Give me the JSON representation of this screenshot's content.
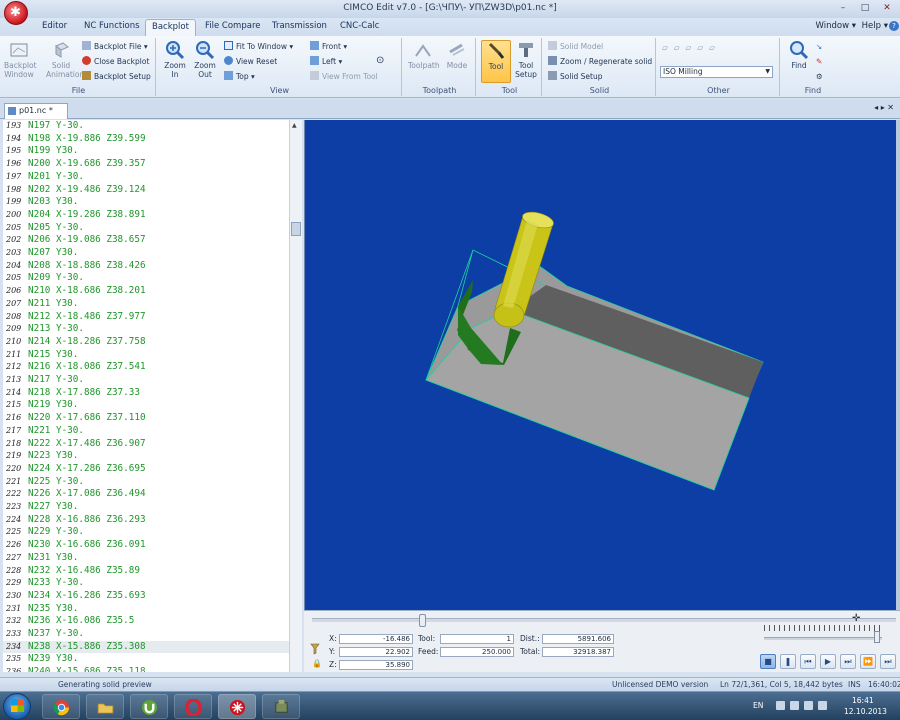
{
  "window": {
    "title": "CIMCO Edit v7.0 - [G:\\ЧПУ\\- УП\\ZW3D\\p01.nc *]",
    "minimize": "–",
    "maximize": "□",
    "close": "✕"
  },
  "menu": {
    "tabs": [
      "Editor",
      "NC Functions",
      "Backplot",
      "File Compare",
      "Transmission",
      "CNC-Calc"
    ],
    "active": "Backplot",
    "window_label": "Window ▾",
    "help_label": "Help ▾"
  },
  "ribbon": {
    "file": {
      "label": "File",
      "backplot_window": "Backplot Window",
      "solid_animation": "Solid Animation",
      "backplot_file": "Backplot File ▾",
      "close_backplot": "Close Backplot",
      "backplot_setup": "Backplot Setup"
    },
    "view": {
      "label": "View",
      "zoom_in": "Zoom In",
      "zoom_out": "Zoom Out",
      "fit_to_window": "Fit To Window ▾",
      "view_reset": "View Reset",
      "top": "Top ▾",
      "front": "Front ▾",
      "left": "Left ▾",
      "view_from_tool": "View From Tool"
    },
    "toolpath": {
      "label": "Toolpath",
      "toolpath": "Toolpath",
      "mode": "Mode"
    },
    "tool": {
      "label": "Tool",
      "tool": "Tool",
      "tool_setup": "Tool Setup"
    },
    "solid": {
      "label": "Solid",
      "solid_model": "Solid Model",
      "zoom_regenerate": "Zoom / Regenerate solid",
      "solid_setup": "Solid Setup"
    },
    "other": {
      "label": "Other",
      "machine_type": "ISO Milling"
    },
    "find": {
      "label": "Find",
      "find": "Find"
    }
  },
  "document_tab": {
    "name": "p01.nc *"
  },
  "editor": {
    "current_line": 234,
    "lines": [
      {
        "n": "193",
        "code": "N197 Y-30."
      },
      {
        "n": "194",
        "code": "N198 X-19.886 Z39.599"
      },
      {
        "n": "195",
        "code": "N199 Y30."
      },
      {
        "n": "196",
        "code": "N200 X-19.686 Z39.357"
      },
      {
        "n": "197",
        "code": "N201 Y-30."
      },
      {
        "n": "198",
        "code": "N202 X-19.486 Z39.124"
      },
      {
        "n": "199",
        "code": "N203 Y30."
      },
      {
        "n": "200",
        "code": "N204 X-19.286 Z38.891"
      },
      {
        "n": "205",
        "code": "N205 Y-30."
      },
      {
        "n": "202",
        "code": "N206 X-19.086 Z38.657"
      },
      {
        "n": "203",
        "code": "N207 Y30."
      },
      {
        "n": "204",
        "code": "N208 X-18.886 Z38.426"
      },
      {
        "n": "205",
        "code": "N209 Y-30."
      },
      {
        "n": "206",
        "code": "N210 X-18.686 Z38.201"
      },
      {
        "n": "207",
        "code": "N211 Y30."
      },
      {
        "n": "208",
        "code": "N212 X-18.486 Z37.977"
      },
      {
        "n": "209",
        "code": "N213 Y-30."
      },
      {
        "n": "210",
        "code": "N214 X-18.286 Z37.758"
      },
      {
        "n": "211",
        "code": "N215 Y30."
      },
      {
        "n": "212",
        "code": "N216 X-18.086 Z37.541"
      },
      {
        "n": "213",
        "code": "N217 Y-30."
      },
      {
        "n": "214",
        "code": "N218 X-17.886 Z37.33"
      },
      {
        "n": "215",
        "code": "N219 Y30."
      },
      {
        "n": "216",
        "code": "N220 X-17.686 Z37.110"
      },
      {
        "n": "217",
        "code": "N221 Y-30."
      },
      {
        "n": "218",
        "code": "N222 X-17.486 Z36.907"
      },
      {
        "n": "219",
        "code": "N223 Y30."
      },
      {
        "n": "220",
        "code": "N224 X-17.286 Z36.695"
      },
      {
        "n": "221",
        "code": "N225 Y-30."
      },
      {
        "n": "222",
        "code": "N226 X-17.086 Z36.494"
      },
      {
        "n": "223",
        "code": "N227 Y30."
      },
      {
        "n": "224",
        "code": "N228 X-16.886 Z36.293"
      },
      {
        "n": "225",
        "code": "N229 Y-30."
      },
      {
        "n": "226",
        "code": "N230 X-16.686 Z36.091"
      },
      {
        "n": "227",
        "code": "N231 Y30."
      },
      {
        "n": "228",
        "code": "N232 X-16.486 Z35.89"
      },
      {
        "n": "229",
        "code": "N233 Y-30."
      },
      {
        "n": "230",
        "code": "N234 X-16.286 Z35.693"
      },
      {
        "n": "231",
        "code": "N235 Y30."
      },
      {
        "n": "232",
        "code": "N236 X-16.086 Z35.5"
      },
      {
        "n": "233",
        "code": "N237 Y-30."
      },
      {
        "n": "234",
        "code": "N238 X-15.886 Z35.308"
      },
      {
        "n": "235",
        "code": "N239 Y30."
      },
      {
        "n": "236",
        "code": "N240 X-15.686 Z35.118"
      }
    ]
  },
  "backplot_info": {
    "x_label": "X:",
    "x_value": "-16.486",
    "y_label": "Y:",
    "y_value": "22.902",
    "z_label": "Z:",
    "z_value": "35.890",
    "tool_label": "Tool:",
    "tool_value": "1",
    "feed_label": "Feed:",
    "feed_value": "250.000",
    "dist_label": "Dist.:",
    "dist_value": "5891.606",
    "total_label": "Total:",
    "total_value": "32918.387",
    "timeline_fraction": 0.19
  },
  "controls": {
    "stop": "■",
    "pause": "❚",
    "step_back": "⏮",
    "play": "▶",
    "step": "⏭",
    "fast": "⏩",
    "end": "⏭"
  },
  "status": {
    "message": "Generating solid preview",
    "license": "Unlicensed DEMO version",
    "position": "Ln 72/1,361, Col 5, 18,442 bytes",
    "ins": "INS",
    "time": "16:40:02"
  },
  "taskbar": {
    "lang": "EN",
    "clock_time": "16:41",
    "clock_date": "12.10.2013"
  },
  "colors": {
    "viewport_bg": "#0c3ea5",
    "code_text": "#21962c",
    "stock_top": "#9a9a9a",
    "stock_side": "#5f5f5f",
    "tool": "#c9c417",
    "cut": "#1f6e1c"
  }
}
